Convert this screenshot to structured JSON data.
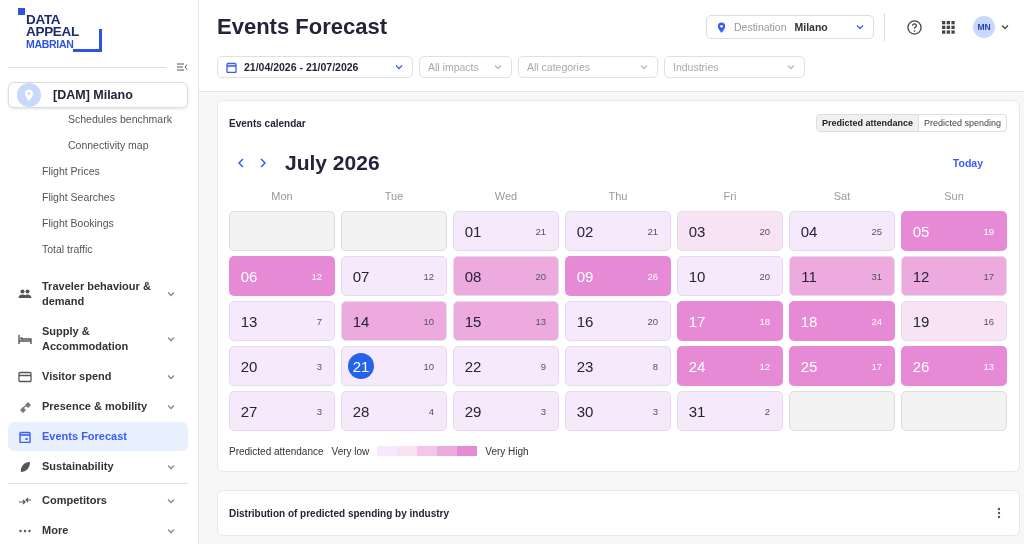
{
  "sidebar": {
    "logo": [
      "DATA",
      "APPEAL",
      "MABRIAN"
    ],
    "destination": "[DAM] Milano",
    "links": [
      {
        "children": [
          {
            "label": "Schedules benchmark"
          },
          {
            "label": "Connectivity map"
          }
        ]
      },
      {
        "label": "Flight Prices"
      },
      {
        "label": "Flight Searches"
      },
      {
        "label": "Flight Bookings"
      },
      {
        "label": "Total traffic"
      }
    ],
    "sections": [
      {
        "label": "Traveler behaviour & demand",
        "selected": false,
        "expandable": true
      },
      {
        "label": "Supply & Accommodation",
        "selected": false,
        "expandable": true
      },
      {
        "label": "Visitor spend",
        "selected": false,
        "expandable": true
      },
      {
        "label": "Presence & mobility",
        "selected": false,
        "expandable": true
      },
      {
        "label": "Events Forecast",
        "selected": true,
        "expandable": false
      },
      {
        "label": "Sustainability",
        "selected": false,
        "expandable": true
      }
    ],
    "footer_sections": [
      {
        "label": "Competitors",
        "selected": false,
        "expandable": true
      },
      {
        "label": "More",
        "selected": false,
        "expandable": true
      }
    ]
  },
  "header": {
    "title": "Events Forecast",
    "destination_label": "Destination",
    "destination_value": "Milano",
    "avatar": "MN",
    "filters": [
      {
        "text": "21/04/2026 - 21/07/2026",
        "active": true
      },
      {
        "text": "All impacts",
        "active": false
      },
      {
        "text": "All categories",
        "active": false
      },
      {
        "text": "Industries",
        "active": false
      }
    ]
  },
  "calendar_card": {
    "title": "Events calendar",
    "toggle": [
      {
        "label": "Predicted attendance",
        "selected": true
      },
      {
        "label": "Predicted spending",
        "selected": false
      }
    ],
    "month": "July 2026",
    "today_button": "Today",
    "weekdays": [
      "Mon",
      "Tue",
      "Wed",
      "Thu",
      "Fri",
      "Sat",
      "Sun"
    ],
    "days": [
      {
        "kind": "empty"
      },
      {
        "kind": "empty"
      },
      {
        "kind": "day",
        "date": "01",
        "count": "21",
        "color": "#f5e9fb",
        "today": false
      },
      {
        "kind": "day",
        "date": "02",
        "count": "21",
        "color": "#f5e9fb",
        "today": false
      },
      {
        "kind": "day",
        "date": "03",
        "count": "20",
        "color": "#f7e3f3",
        "today": false
      },
      {
        "kind": "day",
        "date": "04",
        "count": "25",
        "color": "#f5e9fb",
        "today": false
      },
      {
        "kind": "day",
        "date": "05",
        "count": "19",
        "color": "#e78ad5",
        "today": false
      },
      {
        "kind": "day",
        "date": "06",
        "count": "12",
        "color": "#e78ad5",
        "today": false
      },
      {
        "kind": "day",
        "date": "07",
        "count": "12",
        "color": "#f5e9fb",
        "today": false
      },
      {
        "kind": "day",
        "date": "08",
        "count": "20",
        "color": "#ecaadf",
        "today": false
      },
      {
        "kind": "day",
        "date": "09",
        "count": "26",
        "color": "#e78ad5",
        "today": false
      },
      {
        "kind": "day",
        "date": "10",
        "count": "20",
        "color": "#f5e9fb",
        "today": false
      },
      {
        "kind": "day",
        "date": "11",
        "count": "31",
        "color": "#ecaadf",
        "today": false
      },
      {
        "kind": "day",
        "date": "12",
        "count": "17",
        "color": "#ecaadf",
        "today": false
      },
      {
        "kind": "day",
        "date": "13",
        "count": "7",
        "color": "#f5e9fb",
        "today": false
      },
      {
        "kind": "day",
        "date": "14",
        "count": "10",
        "color": "#ecaadf",
        "today": false
      },
      {
        "kind": "day",
        "date": "15",
        "count": "13",
        "color": "#ecaadf",
        "today": false
      },
      {
        "kind": "day",
        "date": "16",
        "count": "20",
        "color": "#f5e9fb",
        "today": false
      },
      {
        "kind": "day",
        "date": "17",
        "count": "18",
        "color": "#e78ad5",
        "today": false
      },
      {
        "kind": "day",
        "date": "18",
        "count": "24",
        "color": "#e78ad5",
        "today": false
      },
      {
        "kind": "day",
        "date": "19",
        "count": "16",
        "color": "#f7e3f3",
        "today": false
      },
      {
        "kind": "day",
        "date": "20",
        "count": "3",
        "color": "#f5e9fb",
        "today": false
      },
      {
        "kind": "day",
        "date": "21",
        "count": "10",
        "color": "#f5e9fb",
        "today": true
      },
      {
        "kind": "day",
        "date": "22",
        "count": "9",
        "color": "#f5e9fb",
        "today": false
      },
      {
        "kind": "day",
        "date": "23",
        "count": "8",
        "color": "#f5e9fb",
        "today": false
      },
      {
        "kind": "day",
        "date": "24",
        "count": "12",
        "color": "#e78ad5",
        "today": false
      },
      {
        "kind": "day",
        "date": "25",
        "count": "17",
        "color": "#e78ad5",
        "today": false
      },
      {
        "kind": "day",
        "date": "26",
        "count": "13",
        "color": "#e78ad5",
        "today": false
      },
      {
        "kind": "day",
        "date": "27",
        "count": "3",
        "color": "#f5e9fb",
        "today": false
      },
      {
        "kind": "day",
        "date": "28",
        "count": "4",
        "color": "#f5e9fb",
        "today": false
      },
      {
        "kind": "day",
        "date": "29",
        "count": "3",
        "color": "#f5e9fb",
        "today": false
      },
      {
        "kind": "day",
        "date": "30",
        "count": "3",
        "color": "#f5e9fb",
        "today": false
      },
      {
        "kind": "day",
        "date": "31",
        "count": "2",
        "color": "#f5e9fb",
        "today": false
      },
      {
        "kind": "empty"
      },
      {
        "kind": "empty"
      }
    ],
    "legend": {
      "title": "Predicted attendance",
      "low": "Very low",
      "high": "Very High",
      "swatches": [
        {
          "color": "#f5e9fb"
        },
        {
          "color": "#f7e3f3"
        },
        {
          "color": "#f3c6e9"
        },
        {
          "color": "#ecaadf"
        },
        {
          "color": "#e78ad5"
        }
      ]
    }
  },
  "spending_card": {
    "title": "Distribution of predicted spending by industry"
  }
}
